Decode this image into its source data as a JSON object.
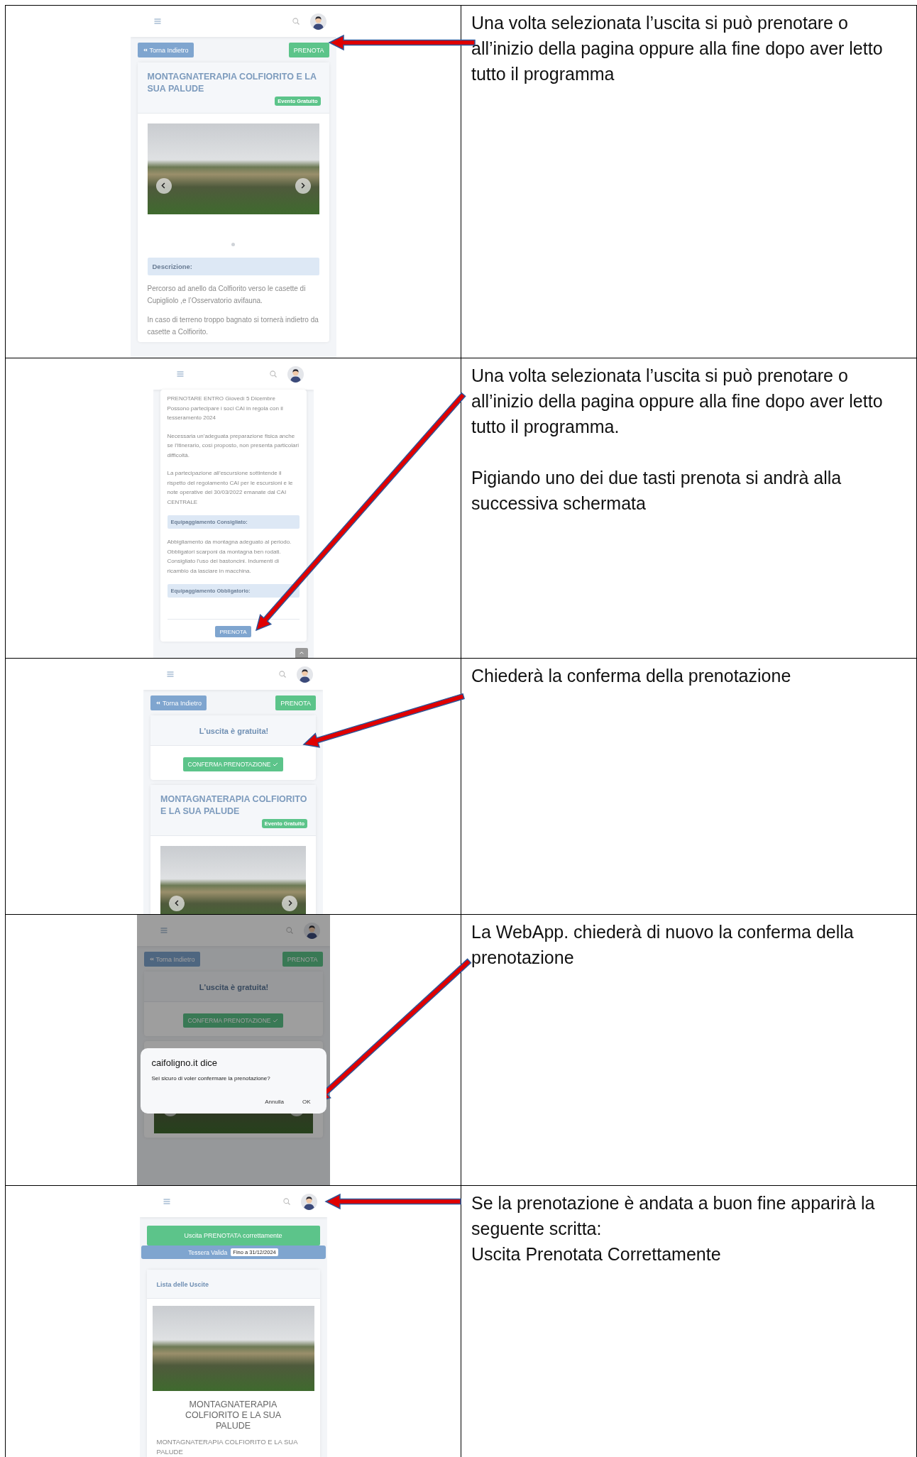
{
  "steps": [
    {
      "screen": {
        "kind": "detail",
        "dimmed": false,
        "blocks": [
          {
            "kind": "actions",
            "back": "Torna Indietro",
            "book": "PRENOTA"
          },
          {
            "kind": "card",
            "title": "MONTAGNATERAPIA COLFIORITO E LA SUA PALUDE",
            "badge": "Evento Gratuito",
            "items": [
              {
                "kind": "carousel",
                "indicator": true
              },
              {
                "kind": "heading",
                "text": "Descrizione:"
              },
              {
                "kind": "paragraph",
                "text": "Percorso ad anello da Colfiorito verso le casette di Cupigliolo ,e l’Osservatorio avifauna."
              },
              {
                "kind": "paragraph",
                "text": "In caso di terreno troppo bagnato si tornerà indietro da casette a Colfiorito."
              }
            ]
          }
        ]
      },
      "description": [
        "Una volta selezionata l’uscita si può prenotare o all’inizio della pagina oppure alla fine dopo aver letto tutto il programma"
      ]
    },
    {
      "screen": {
        "kind": "bottom",
        "dimmed": false,
        "blocks": [
          {
            "kind": "card",
            "items": [
              {
                "kind": "paragraph",
                "text": "PRENOTARE ENTRO Giovedì 5 Dicembre\nPossono partecipare i soci CAI in regola con il tesseramento 2024"
              },
              {
                "kind": "paragraph",
                "text": "Necessaria un’adeguata preparazione fisica anche se l’itinerario, così proposto, non presenta particolari difficoltà."
              },
              {
                "kind": "paragraph",
                "text": "La partecipazione all’escursione sottintende il rispetto del regolamento CAI per le escursioni e le note operative del 30/03/2022 emanate dal CAI CENTRALE"
              },
              {
                "kind": "heading",
                "text": "Equipaggiamento Consigliato:"
              },
              {
                "kind": "paragraph",
                "text": "Abbigliamento da montagna adeguato al periodo. Obbligatori scarponi da montagna ben rodati. Consigliato l’uso dei bastoncini. Indumenti di ricambio da lasciare in macchina."
              },
              {
                "kind": "heading",
                "text": "Equipaggiamento Obbligatorio:"
              },
              {
                "kind": "footer_button",
                "text": "PRENOTA"
              }
            ]
          },
          {
            "kind": "scroll_top"
          }
        ]
      },
      "description": [
        "Una volta selezionata l’uscita si può prenotare o all’inizio della pagina oppure alla fine dopo aver letto tutto il programma.",
        "Pigiando uno dei due tasti prenota si andrà alla successiva schermata"
      ]
    },
    {
      "screen": {
        "kind": "confirm",
        "dimmed": false,
        "blocks": [
          {
            "kind": "actions",
            "back": "Torna Indietro",
            "book": "PRENOTA"
          },
          {
            "kind": "card",
            "header_text": "L'uscita è gratuita!",
            "items": [
              {
                "kind": "confirm",
                "text": "CONFERMA PRENOTAZIONE"
              }
            ]
          },
          {
            "kind": "card",
            "title": "MONTAGNATERAPIA COLFIORITO E LA SUA PALUDE",
            "badge": "Evento Gratuito",
            "items": [
              {
                "kind": "carousel",
                "indicator": false
              }
            ]
          }
        ]
      },
      "description": [
        "Chiederà la conferma della prenotazione"
      ]
    },
    {
      "screen": {
        "kind": "dialog",
        "dimmed": true,
        "blocks": [
          {
            "kind": "actions",
            "back": "Torna Indietro",
            "book": "PRENOTA"
          },
          {
            "kind": "card",
            "header_text": "L'uscita è gratuita!",
            "items": [
              {
                "kind": "confirm",
                "text": "CONFERMA PRENOTAZIONE"
              }
            ]
          },
          {
            "kind": "card",
            "items": [
              {
                "kind": "carousel",
                "indicator": false
              }
            ]
          }
        ],
        "dialog": {
          "title": "caifoligno.it dice",
          "message": "Sei sicuro di voler confermare la prenotazione?",
          "buttons": [
            "Annulla",
            "OK"
          ]
        }
      },
      "description": [
        "La WebApp. chiederà di nuovo la conferma della prenotazione"
      ]
    },
    {
      "screen": {
        "kind": "success",
        "dimmed": false,
        "blocks": [
          {
            "kind": "alert",
            "text": "Uscita PRENOTATA correttamente"
          },
          {
            "kind": "membership",
            "text": "Tessera Valida",
            "badge": "Fino a 31/12/2024"
          },
          {
            "kind": "card",
            "header_text": "Lista delle Uscite",
            "items": [
              {
                "kind": "photo"
              },
              {
                "kind": "title",
                "text": "MONTAGNATERAPIA COLFIORITO E LA SUA PALUDE"
              },
              {
                "kind": "subtitle",
                "text": "MONTAGNATERAPIA COLFIORITO E LA SUA PALUDE"
              }
            ]
          }
        ]
      },
      "description": [
        "Se la prenotazione è andata a buon fine apparirà la seguente scritta:",
        "Uscita Prenotata Correttamente"
      ]
    }
  ]
}
